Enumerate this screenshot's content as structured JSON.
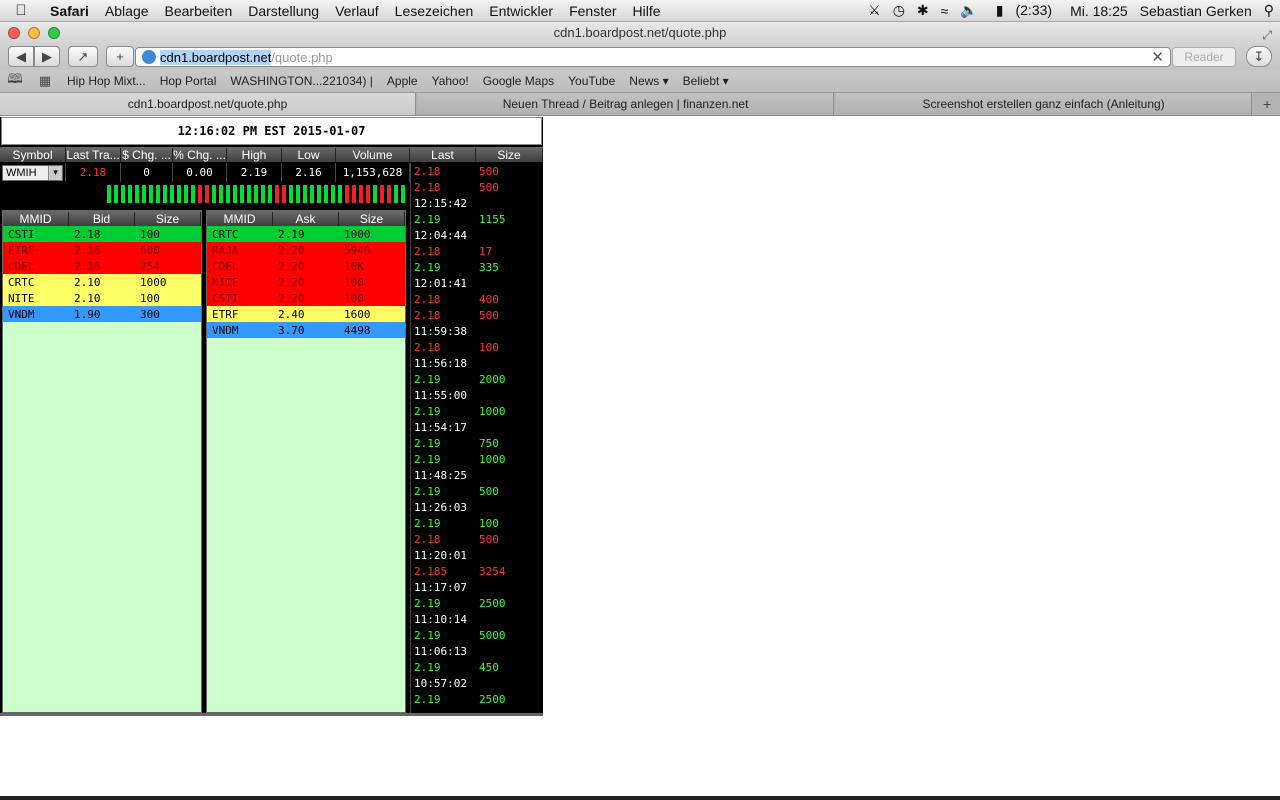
{
  "menubar": {
    "app": "Safari",
    "items": [
      "Ablage",
      "Bearbeiten",
      "Darstellung",
      "Verlauf",
      "Lesezeichen",
      "Entwickler",
      "Fenster",
      "Hilfe"
    ],
    "battery": "(2:33)",
    "clock": "Mi. 18:25",
    "user": "Sebastian Gerken"
  },
  "window": {
    "title": "cdn1.boardpost.net/quote.php"
  },
  "url": {
    "host": "cdn1.boardpost.net",
    "path": "/quote.php",
    "reader_label": "Reader"
  },
  "bookmarks": [
    "Hip Hop Mixt...",
    "Hop Portal",
    "WASHINGTON...221034) |",
    "Apple",
    "Yahoo!",
    "Google Maps",
    "YouTube",
    "News ▾",
    "Beliebt ▾"
  ],
  "tabs": [
    {
      "label": "cdn1.boardpost.net/quote.php"
    },
    {
      "label": "Neuen Thread / Beitrag anlegen | finanzen.net"
    },
    {
      "label": "Screenshot erstellen ganz einfach (Anleitung)"
    }
  ],
  "quote": {
    "timestamp": "12:16:02 PM EST 2015-01-07",
    "summary_headers": [
      "Symbol",
      "Last Tra...",
      "$ Chg. ...",
      "% Chg. ...",
      "High",
      "Low",
      "Volume"
    ],
    "symbol": "WMIH",
    "last": "2.18",
    "chg": "0",
    "pct_chg": "0.00",
    "high": "2.19",
    "low": "2.16",
    "volume": "1,153,628",
    "tick_colors": [
      "green",
      "green",
      "green",
      "green",
      "green",
      "green",
      "green",
      "green",
      "green",
      "green",
      "green",
      "green",
      "green",
      "red",
      "red",
      "green",
      "green",
      "green",
      "green",
      "green",
      "green",
      "green",
      "green",
      "green",
      "red",
      "red",
      "green",
      "green",
      "green",
      "green",
      "green",
      "green",
      "green",
      "green",
      "red",
      "red",
      "red",
      "red",
      "green",
      "red",
      "red",
      "green",
      "green"
    ],
    "bid_headers": [
      "MMID",
      "Bid",
      "Size"
    ],
    "bids": [
      {
        "mmid": "CSTI",
        "price": "2.18",
        "size": "100",
        "color": "green"
      },
      {
        "mmid": "ETRF",
        "price": "2.16",
        "size": "600",
        "color": "red"
      },
      {
        "mmid": "CDEL",
        "price": "2.16",
        "size": "254",
        "color": "red"
      },
      {
        "mmid": "CRTC",
        "price": "2.10",
        "size": "1000",
        "color": "yellow"
      },
      {
        "mmid": "NITE",
        "price": "2.10",
        "size": "100",
        "color": "yellow"
      },
      {
        "mmid": "VNDM",
        "price": "1.90",
        "size": "300",
        "color": "blue"
      }
    ],
    "ask_headers": [
      "MMID",
      "Ask",
      "Size"
    ],
    "asks": [
      {
        "mmid": "CRTC",
        "price": "2.19",
        "size": "1000",
        "color": "green"
      },
      {
        "mmid": "RAJA",
        "price": "2.20",
        "size": "5940",
        "color": "red"
      },
      {
        "mmid": "CDEL",
        "price": "2.20",
        "size": "10K",
        "color": "red"
      },
      {
        "mmid": "NITE",
        "price": "2.20",
        "size": "100",
        "color": "red"
      },
      {
        "mmid": "CSTI",
        "price": "2.20",
        "size": "100",
        "color": "red"
      },
      {
        "mmid": "ETRF",
        "price": "2.40",
        "size": "1600",
        "color": "yellow"
      },
      {
        "mmid": "VNDM",
        "price": "3.70",
        "size": "4498",
        "color": "blue"
      }
    ],
    "ts_headers": [
      "Last",
      "Size"
    ],
    "trades": [
      {
        "kind": "down",
        "price": "2.18",
        "size": "500"
      },
      {
        "kind": "down",
        "price": "2.18",
        "size": "500"
      },
      {
        "kind": "time",
        "text": "12:15:42"
      },
      {
        "kind": "up",
        "price": "2.19",
        "size": "1155"
      },
      {
        "kind": "time",
        "text": "12:04:44"
      },
      {
        "kind": "down",
        "price": "2.18",
        "size": "17"
      },
      {
        "kind": "up",
        "price": "2.19",
        "size": "335"
      },
      {
        "kind": "time",
        "text": "12:01:41"
      },
      {
        "kind": "down",
        "price": "2.18",
        "size": "400"
      },
      {
        "kind": "down",
        "price": "2.18",
        "size": "500"
      },
      {
        "kind": "time",
        "text": "11:59:38"
      },
      {
        "kind": "down",
        "price": "2.18",
        "size": "100"
      },
      {
        "kind": "time",
        "text": "11:56:18"
      },
      {
        "kind": "up",
        "price": "2.19",
        "size": "2000"
      },
      {
        "kind": "time",
        "text": "11:55:00"
      },
      {
        "kind": "up",
        "price": "2.19",
        "size": "1000"
      },
      {
        "kind": "time",
        "text": "11:54:17"
      },
      {
        "kind": "up",
        "price": "2.19",
        "size": "750"
      },
      {
        "kind": "up",
        "price": "2.19",
        "size": "1000"
      },
      {
        "kind": "time",
        "text": "11:48:25"
      },
      {
        "kind": "up",
        "price": "2.19",
        "size": "500"
      },
      {
        "kind": "time",
        "text": "11:26:03"
      },
      {
        "kind": "up",
        "price": "2.19",
        "size": "100"
      },
      {
        "kind": "down",
        "price": "2.18",
        "size": "500"
      },
      {
        "kind": "time",
        "text": "11:20:01"
      },
      {
        "kind": "down",
        "price": "2.185",
        "size": "3254"
      },
      {
        "kind": "time",
        "text": "11:17:07"
      },
      {
        "kind": "up",
        "price": "2.19",
        "size": "2500"
      },
      {
        "kind": "time",
        "text": "11:10:14"
      },
      {
        "kind": "up",
        "price": "2.19",
        "size": "5000"
      },
      {
        "kind": "time",
        "text": "11:06:13"
      },
      {
        "kind": "up",
        "price": "2.19",
        "size": "450"
      },
      {
        "kind": "time",
        "text": "10:57:02"
      },
      {
        "kind": "up",
        "price": "2.19",
        "size": "2500"
      }
    ]
  },
  "colors": {
    "up": "#33ff33",
    "down": "#ff3333",
    "tick_green": "#00dd33",
    "tick_red": "#ee2222",
    "book_bg": "#ccffcc"
  }
}
